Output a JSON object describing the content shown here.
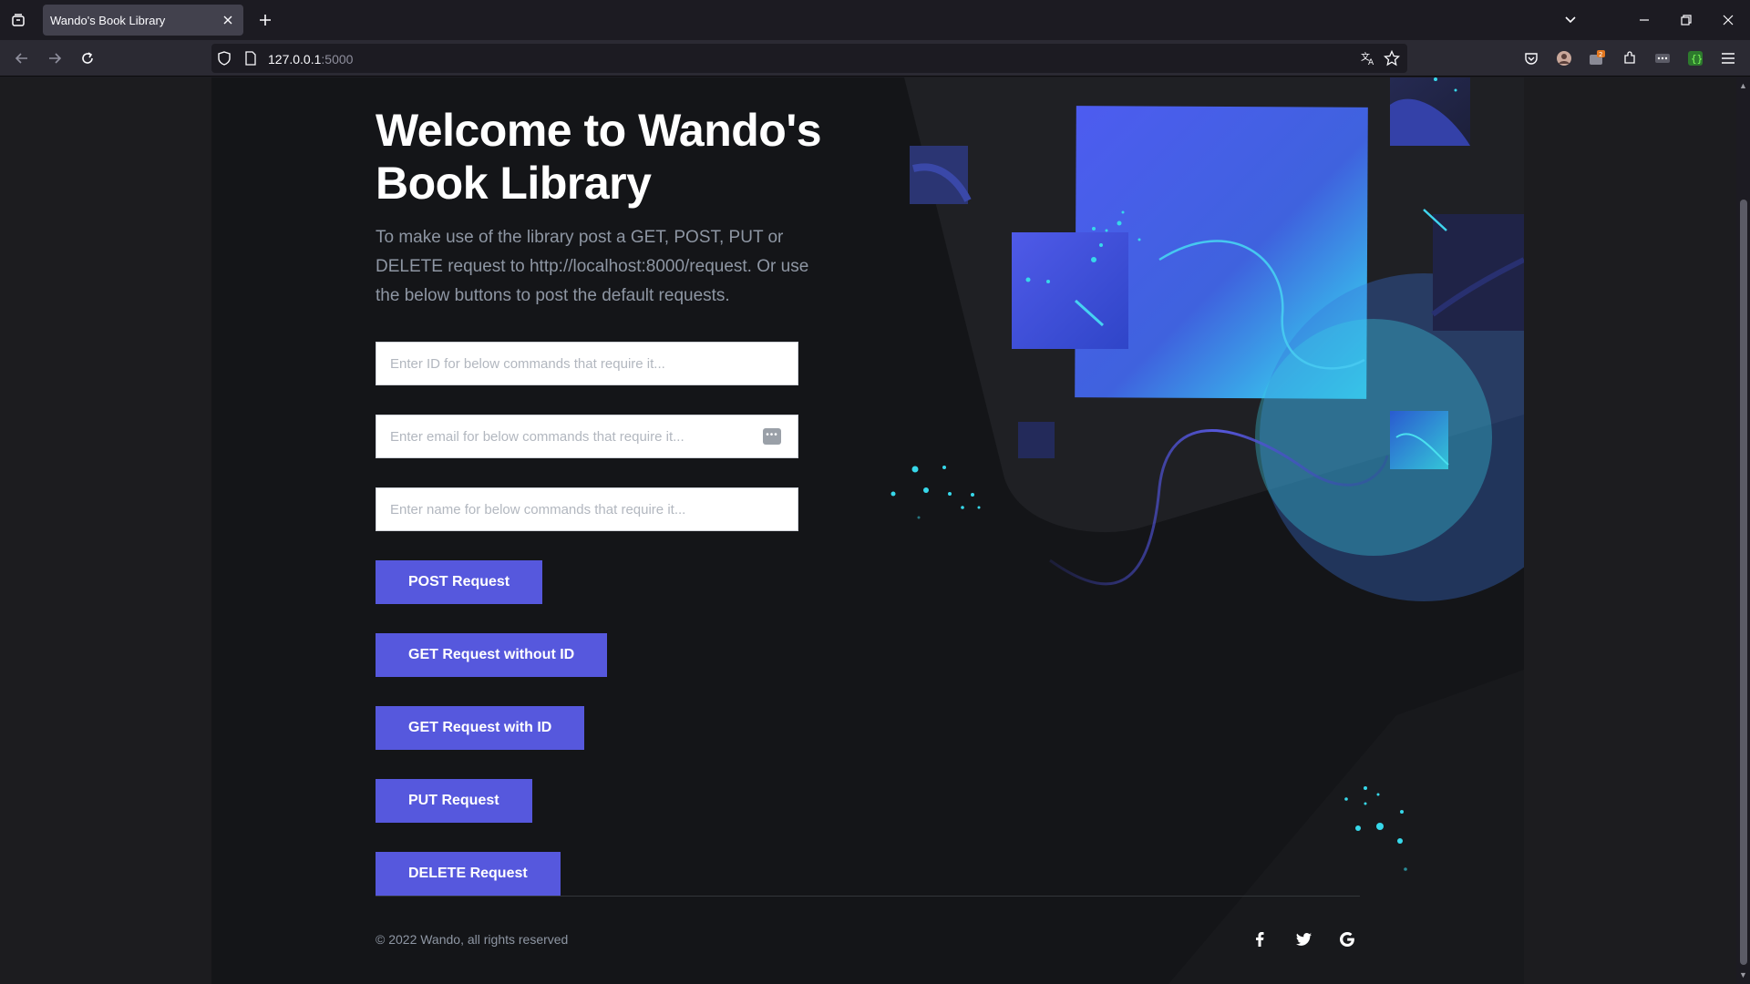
{
  "browser": {
    "tab_title": "Wando's Book Library",
    "url_host": "127.0.0.1",
    "url_port": ":5000"
  },
  "hero": {
    "title": "Welcome to Wando's Book Library",
    "description": "To make use of the library post a GET, POST, PUT or DELETE request to http://localhost:8000/request. Or use the below buttons to post the default requests."
  },
  "form": {
    "id_placeholder": "Enter ID for below commands that require it...",
    "email_placeholder": "Enter email for below commands that require it...",
    "name_placeholder": "Enter name for below commands that require it..."
  },
  "buttons": {
    "post": "POST Request",
    "get_all": "GET Request without ID",
    "get_id": "GET Request with ID",
    "put": "PUT Request",
    "delete": "DELETE Request"
  },
  "footer": {
    "copyright": "© 2022 Wando, all rights reserved",
    "social": [
      "facebook-icon",
      "twitter-icon",
      "google-icon"
    ]
  },
  "colors": {
    "accent": "#5658dd",
    "page_bg": "#141518",
    "teal": "#35e0f0"
  }
}
